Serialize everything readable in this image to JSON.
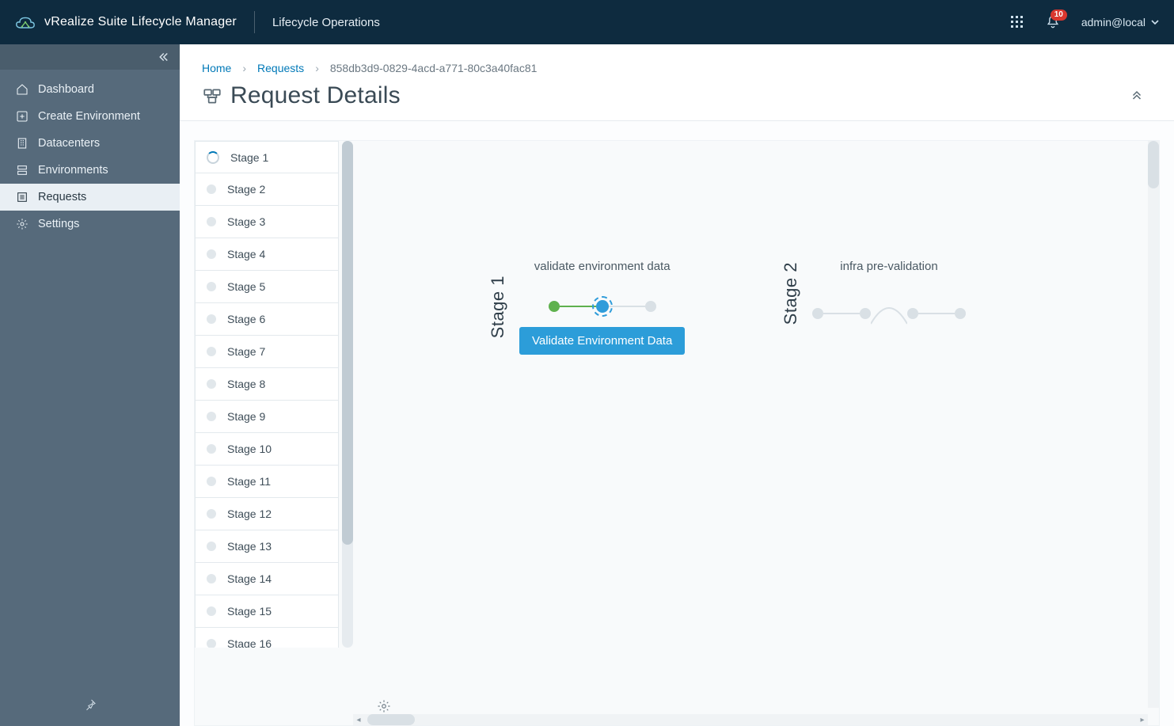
{
  "header": {
    "app_title": "vRealize Suite Lifecycle Manager",
    "section_title": "Lifecycle Operations",
    "notification_count": "10",
    "user_label": "admin@local"
  },
  "sidebar": {
    "items": [
      {
        "label": "Dashboard"
      },
      {
        "label": "Create Environment"
      },
      {
        "label": "Datacenters"
      },
      {
        "label": "Environments"
      },
      {
        "label": "Requests"
      },
      {
        "label": "Settings"
      }
    ]
  },
  "breadcrumb": {
    "home": "Home",
    "requests": "Requests",
    "current": "858db3d9-0829-4acd-a771-80c3a40fac81"
  },
  "page": {
    "title": "Request Details"
  },
  "stages": [
    "Stage 1",
    "Stage 2",
    "Stage 3",
    "Stage 4",
    "Stage 5",
    "Stage 6",
    "Stage 7",
    "Stage 8",
    "Stage 9",
    "Stage 10",
    "Stage 11",
    "Stage 12",
    "Stage 13",
    "Stage 14",
    "Stage 15",
    "Stage 16"
  ],
  "flow": {
    "group1": {
      "vlabel": "Stage 1",
      "title": "validate environment data",
      "button": "Validate Environment Data"
    },
    "group2": {
      "vlabel": "Stage 2",
      "title": "infra pre-validation"
    }
  }
}
